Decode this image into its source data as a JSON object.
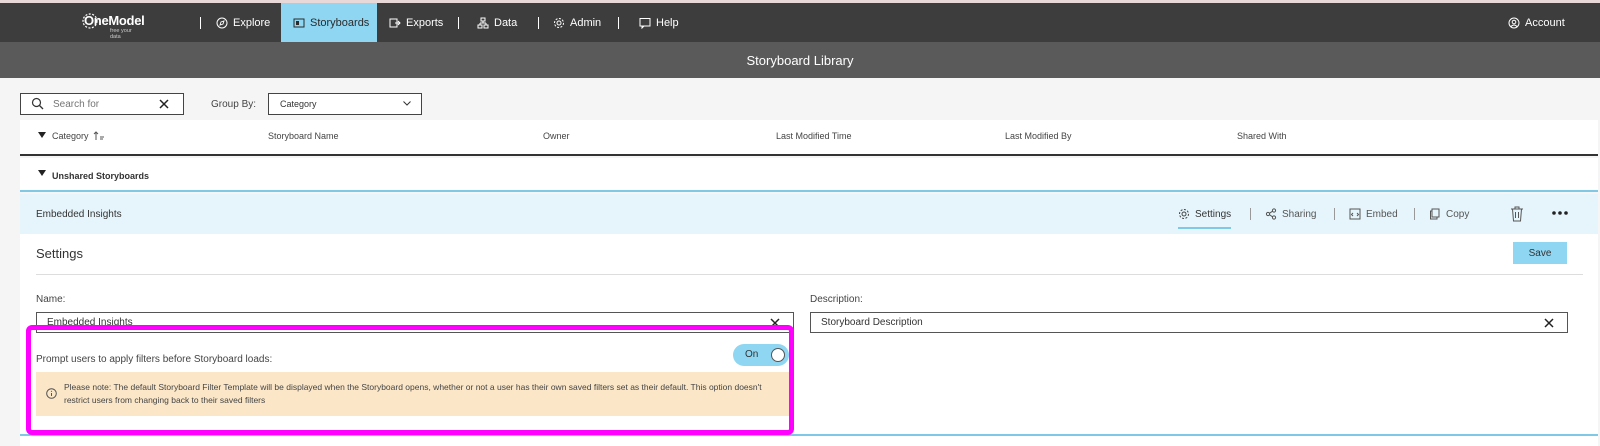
{
  "nav": {
    "logo_text": "OneModel",
    "logo_tagline": "free your data",
    "items": [
      {
        "label": "Explore",
        "icon": "compass-icon"
      },
      {
        "label": "Storyboards",
        "icon": "storyboard-icon",
        "active": true
      },
      {
        "label": "Exports",
        "icon": "export-icon"
      },
      {
        "label": "Data",
        "icon": "data-icon"
      },
      {
        "label": "Admin",
        "icon": "gear-icon"
      },
      {
        "label": "Help",
        "icon": "help-icon"
      }
    ],
    "account_label": "Account"
  },
  "page_title": "Storyboard Library",
  "search": {
    "placeholder": "Search for",
    "value": ""
  },
  "group_by": {
    "label": "Group By:",
    "value": "Category"
  },
  "table": {
    "columns": [
      "Category",
      "Storyboard Name",
      "Owner",
      "Last Modified Time",
      "Last Modified By",
      "Shared With"
    ]
  },
  "group_row": {
    "label": "Unshared Storyboards"
  },
  "panel": {
    "title": "Embedded Insights",
    "tabs": [
      {
        "label": "Settings",
        "icon": "gear-icon",
        "active": true
      },
      {
        "label": "Sharing",
        "icon": "share-icon"
      },
      {
        "label": "Embed",
        "icon": "embed-icon"
      },
      {
        "label": "Copy",
        "icon": "copy-icon"
      }
    ]
  },
  "settings": {
    "title": "Settings",
    "save_label": "Save",
    "name_label": "Name:",
    "name_value": "Embedded Insights",
    "description_label": "Description:",
    "description_value": "Storyboard Description",
    "prompt_label": "Prompt users to apply filters before Storyboard loads:",
    "toggle_label": "On",
    "note": "Please note: The default Storyboard Filter Template will be displayed when the Storyboard opens, whether or not a user has their own saved filters set as their default. This option doesn't restrict users from changing back to their saved filters"
  },
  "colors": {
    "nav_bg": "#3d3d3d",
    "active_tab": "#8fd6f2",
    "title_bg": "#5a5a5a",
    "panel_head_bg": "#e6f5fb",
    "note_bg": "#fbe7c8",
    "highlight": "#ff00ff"
  }
}
